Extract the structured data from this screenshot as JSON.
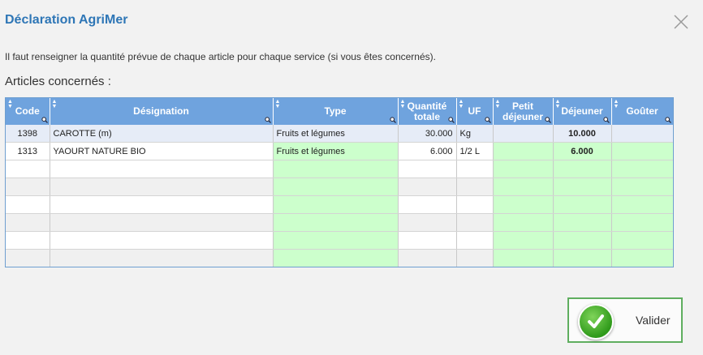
{
  "dialog": {
    "title": "Déclaration AgriMer",
    "intro": "Il faut renseigner la quantité prévue de chaque article pour chaque service (si vous êtes concernés).",
    "subtitle": "Articles concernés :",
    "validate_label": "Valider"
  },
  "table": {
    "headers": {
      "code": "Code",
      "designation": "Désignation",
      "type": "Type",
      "quantite_l1": "Quantité",
      "quantite_l2": "totale",
      "uf": "UF",
      "petit_l1": "Petit",
      "petit_l2": "déjeuner",
      "dejeuner": "Déjeuner",
      "gouter": "Goûter"
    },
    "rows": [
      {
        "code": "1398",
        "designation": "CAROTTE (m)",
        "type": "Fruits et légumes",
        "quantite": "30.000",
        "uf": "Kg",
        "petit": "",
        "dejeuner": "10.000",
        "gouter": ""
      },
      {
        "code": "1313",
        "designation": "YAOURT NATURE BIO",
        "type": "Fruits et légumes",
        "quantite": "6.000",
        "uf": "1/2 L",
        "petit": "",
        "dejeuner": "6.000",
        "gouter": ""
      }
    ]
  }
}
